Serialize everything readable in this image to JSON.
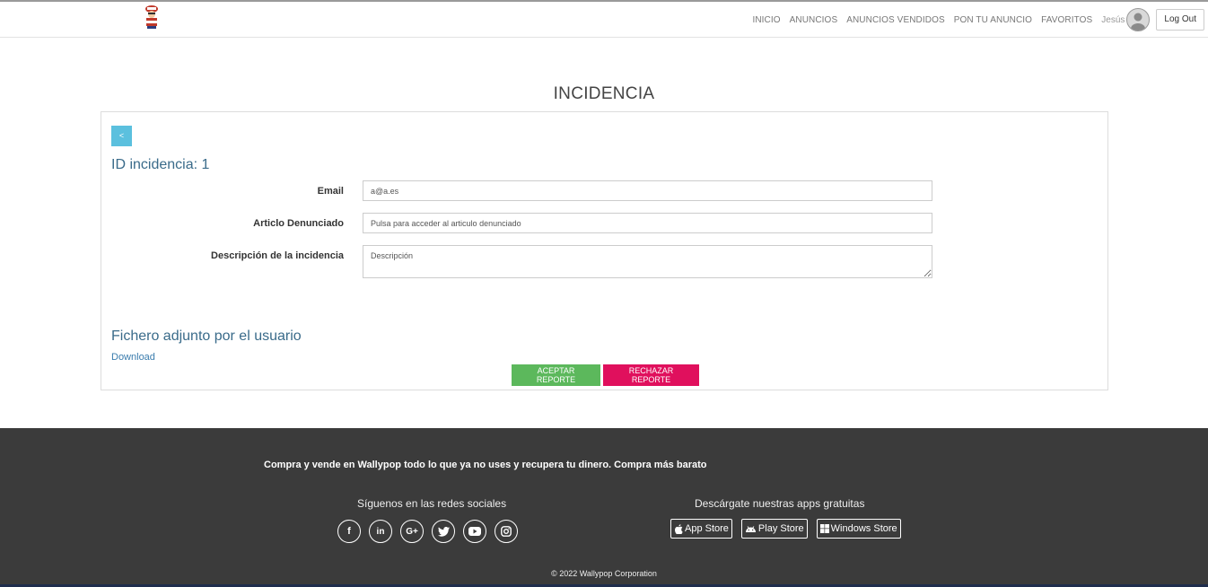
{
  "nav": {
    "items": [
      "INICIO",
      "ANUNCIOS",
      "ANUNCIOS VENDIDOS",
      "PON TU ANUNCIO",
      "FAVORITOS"
    ],
    "user": "Jesús",
    "logout": "Log Out"
  },
  "page": {
    "title": "INCIDENCIA",
    "back_label": "<",
    "id_label": "ID incidencia: 1"
  },
  "form": {
    "email_label": "Email",
    "email_value": "a@a.es",
    "article_label": "Articlo Denunciado",
    "article_value": "Pulsa para acceder al articulo denunciado",
    "description_label": "Descripción de la incidencia",
    "description_placeholder": "Descripción"
  },
  "attachment": {
    "title": "Fichero adjunto por el usuario",
    "link": "Download"
  },
  "actions": {
    "accept": "ACEPTAR REPORTE",
    "reject": "RECHAZAR REPORTE"
  },
  "footer": {
    "tagline": "Compra y vende en Wallypop todo lo que ya no uses y recupera tu dinero. Compra más barato",
    "social_title": "Síguenos en las redes sociales",
    "social_icons": [
      "facebook-icon",
      "linkedin-icon",
      "google-plus-icon",
      "twitter-icon",
      "youtube-icon",
      "instagram-icon"
    ],
    "apps_title": "Descárgate nuestras apps gratuitas",
    "apps": [
      "App Store",
      "Play Store",
      "Windows Store"
    ],
    "copyright": "© 2022 Wallypop Corporation"
  },
  "colors": {
    "accept": "#5cb85c",
    "reject": "#e0105d",
    "back": "#5bc0de",
    "footer_bg": "#3b3b3b",
    "heading": "#3a6b8a"
  }
}
